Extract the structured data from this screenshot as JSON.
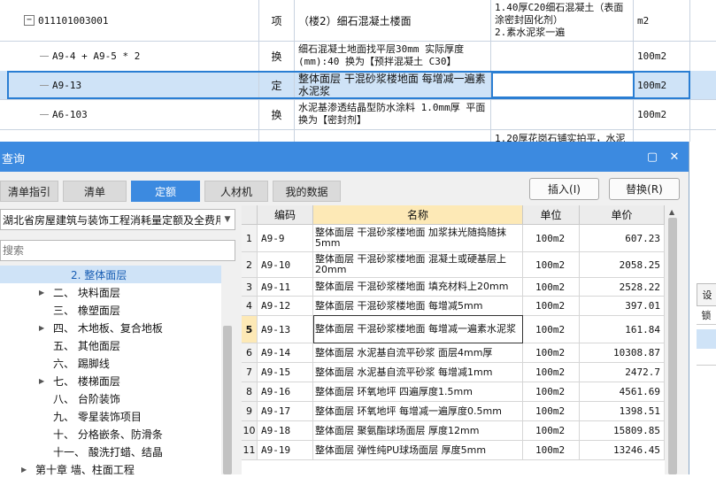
{
  "sheet": {
    "rows": [
      {
        "code": "011101003001",
        "type": "项",
        "name": "（楼2）细石混凝土楼面",
        "desc": "1.40厚C20细石混凝土（表面涂密封固化剂）\n2.素水泥浆一遍",
        "unit": "m2"
      },
      {
        "code": "A9-4 + A9-5 * 2",
        "type": "换",
        "name": "细石混凝土地面找平层30mm  实际厚度(mm):40  换为【预拌混凝土 C30】",
        "desc": "",
        "unit": "100m2"
      },
      {
        "code": "A9-13",
        "type": "定",
        "name": "整体面层 干混砂浆楼地面 每增减一遍素水泥浆",
        "desc": "",
        "unit": "100m2"
      },
      {
        "code": "A6-103",
        "type": "换",
        "name": "水泥基渗透结晶型防水涂料 1.0mm厚 平面  换为【密封剂】",
        "desc": "",
        "unit": "100m2"
      },
      {
        "code": "",
        "type": "",
        "name": "",
        "desc": "1.20厚花岗石铺实拍平，水泥",
        "unit": ""
      }
    ],
    "expander": "−"
  },
  "side_fragments": {
    "a": "设",
    "b": "锁"
  },
  "dialog": {
    "title": "查询",
    "maximize_glyph": "▢",
    "close_glyph": "✕",
    "tabs": [
      "清单指引",
      "清单",
      "定额",
      "人材机",
      "我的数据"
    ],
    "active_tab": "定额",
    "insert_button": "插入(I)",
    "replace_button": "替换(R)",
    "library": "湖北省房屋建筑与装饰工程消耗量定额及全费用",
    "library_dd": "▼",
    "search_placeholder": "搜索",
    "tree": [
      {
        "label": "2. 整体面层",
        "indent": 80,
        "twisty": "",
        "selected": true
      },
      {
        "label": "二、 块料面层",
        "indent": 60,
        "twisty": "▶"
      },
      {
        "label": "三、 橡塑面层",
        "indent": 60,
        "twisty": ""
      },
      {
        "label": "四、 木地板、复合地板",
        "indent": 60,
        "twisty": "▶"
      },
      {
        "label": "五、 其他面层",
        "indent": 60,
        "twisty": ""
      },
      {
        "label": "六、 踢脚线",
        "indent": 60,
        "twisty": ""
      },
      {
        "label": "七、 楼梯面层",
        "indent": 60,
        "twisty": "▶"
      },
      {
        "label": "八、 台阶装饰",
        "indent": 60,
        "twisty": ""
      },
      {
        "label": "九、 零星装饰项目",
        "indent": 60,
        "twisty": ""
      },
      {
        "label": "十、 分格嵌条、防滑条",
        "indent": 60,
        "twisty": ""
      },
      {
        "label": "十一、 酸洗打蜡、结晶",
        "indent": 60,
        "twisty": ""
      },
      {
        "label": "第十章 墙、柱面工程",
        "indent": 40,
        "twisty": "▶"
      }
    ],
    "grid": {
      "headers": [
        "",
        "编码",
        "名称",
        "单位",
        "单价"
      ],
      "rows": [
        {
          "idx": "1",
          "code": "A9-9",
          "name": "整体面层 干混砂浆楼地面 加浆抹光随捣随抹5mm",
          "unit": "100m2",
          "price": "607.23"
        },
        {
          "idx": "2",
          "code": "A9-10",
          "name": "整体面层 干混砂浆楼地面 混凝土或硬基层上20mm",
          "unit": "100m2",
          "price": "2058.25"
        },
        {
          "idx": "3",
          "code": "A9-11",
          "name": "整体面层 干混砂浆楼地面 填充材料上20mm",
          "unit": "100m2",
          "price": "2528.22"
        },
        {
          "idx": "4",
          "code": "A9-12",
          "name": "整体面层 干混砂浆楼地面 每增减5mm",
          "unit": "100m2",
          "price": "397.01"
        },
        {
          "idx": "5",
          "code": "A9-13",
          "name": "整体面层 干混砂浆楼地面 每增减一遍素水泥浆",
          "unit": "100m2",
          "price": "161.84"
        },
        {
          "idx": "6",
          "code": "A9-14",
          "name": "整体面层 水泥基自流平砂浆 面层4mm厚",
          "unit": "100m2",
          "price": "10308.87"
        },
        {
          "idx": "7",
          "code": "A9-15",
          "name": "整体面层 水泥基自流平砂浆 每增减1mm",
          "unit": "100m2",
          "price": "2472.7"
        },
        {
          "idx": "8",
          "code": "A9-16",
          "name": "整体面层 环氧地坪 四遍厚度1.5mm",
          "unit": "100m2",
          "price": "4561.69"
        },
        {
          "idx": "9",
          "code": "A9-17",
          "name": "整体面层 环氧地坪 每增减一遍厚度0.5mm",
          "unit": "100m2",
          "price": "1398.51"
        },
        {
          "idx": "10",
          "code": "A9-18",
          "name": "整体面层 聚氨酯球场面层 厚度12mm",
          "unit": "100m2",
          "price": "15809.85"
        },
        {
          "idx": "11",
          "code": "A9-19",
          "name": "整体面层 弹性纯PU球场面层 厚度5mm",
          "unit": "100m2",
          "price": "13246.45"
        }
      ]
    }
  }
}
